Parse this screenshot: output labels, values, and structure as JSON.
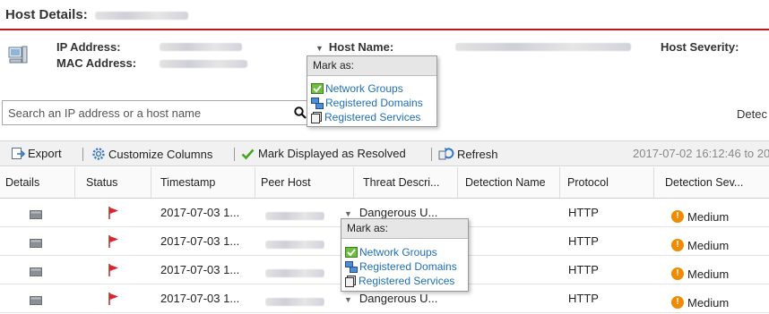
{
  "header": {
    "title": "Host Details:"
  },
  "host": {
    "ip_label": "IP Address:",
    "mac_label": "MAC Address:",
    "host_name_label": "Host Name:",
    "severity_label": "Host Severity:"
  },
  "mark_menu": {
    "head": "Mark as:",
    "items": [
      "Network Groups",
      "Registered Domains",
      "Registered Services"
    ]
  },
  "search": {
    "placeholder": "Search an IP address or a host name"
  },
  "detect_label": "Detec",
  "toolbar": {
    "export": "Export",
    "customize": "Customize Columns",
    "mark_resolved": "Mark Displayed as Resolved",
    "refresh": "Refresh",
    "date_range": "2017-07-02 16:12:46 to 20"
  },
  "table": {
    "columns": [
      "Details",
      "Status",
      "Timestamp",
      "Peer Host",
      "Threat Descri...",
      "Detection Name",
      "Protocol",
      "Detection Sev..."
    ],
    "rows": [
      {
        "timestamp": "2017-07-03 1...",
        "threat": "Dangerous U...",
        "protocol": "HTTP",
        "severity": "Medium"
      },
      {
        "timestamp": "2017-07-03 1...",
        "threat": "",
        "protocol": "HTTP",
        "severity": "Medium"
      },
      {
        "timestamp": "2017-07-03 1...",
        "threat": "",
        "protocol": "HTTP",
        "severity": "Medium"
      },
      {
        "timestamp": "2017-07-03 1...",
        "threat": "Dangerous U...",
        "protocol": "HTTP",
        "severity": "Medium"
      }
    ]
  },
  "colors": {
    "accent_red": "#c0171c",
    "link_blue": "#1f6fb5",
    "severity_orange": "#f08a00"
  }
}
